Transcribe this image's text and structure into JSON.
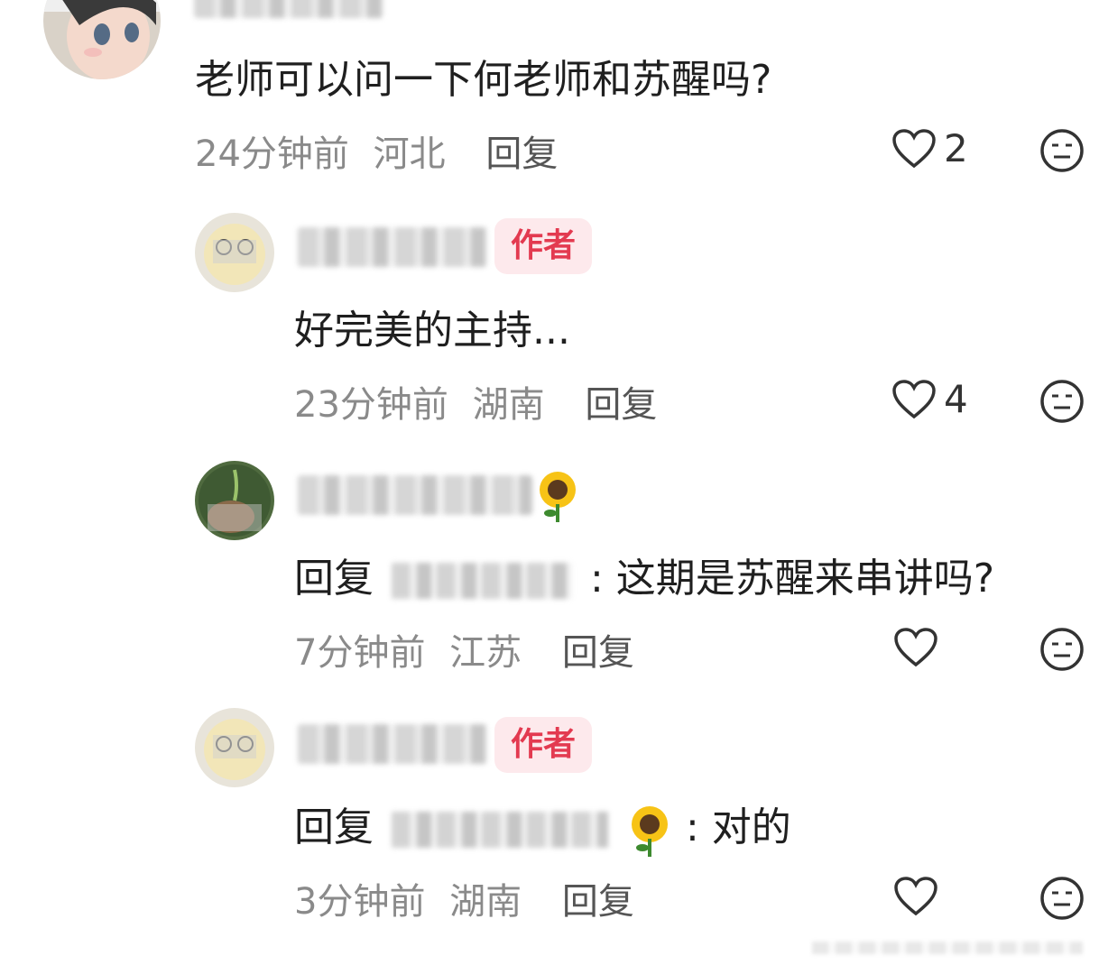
{
  "comments": [
    {
      "text": "老师可以问一下何老师和苏醒吗?",
      "time": "24分钟前",
      "location": "河北",
      "reply_label": "回复",
      "likes": "2"
    },
    {
      "author_tag": "作者",
      "text": "好完美的主持...",
      "time": "23分钟前",
      "location": "湖南",
      "reply_label": "回复",
      "likes": "4"
    },
    {
      "reply_prefix": "回复",
      "text": ": 这期是苏醒来串讲吗?",
      "time": "7分钟前",
      "location": "江苏",
      "reply_label": "回复"
    },
    {
      "author_tag": "作者",
      "reply_prefix": "回复",
      "text": ": 对的",
      "time": "3分钟前",
      "location": "湖南",
      "reply_label": "回复"
    }
  ],
  "icons": {
    "like": "heart-outline-icon",
    "dislike": "meh-face-icon",
    "emoji": "sunflower-emoji"
  },
  "colors": {
    "author_tag_bg": "#fde9ec",
    "author_tag_text": "#e33a50",
    "meta_text": "#8a8a8a"
  }
}
